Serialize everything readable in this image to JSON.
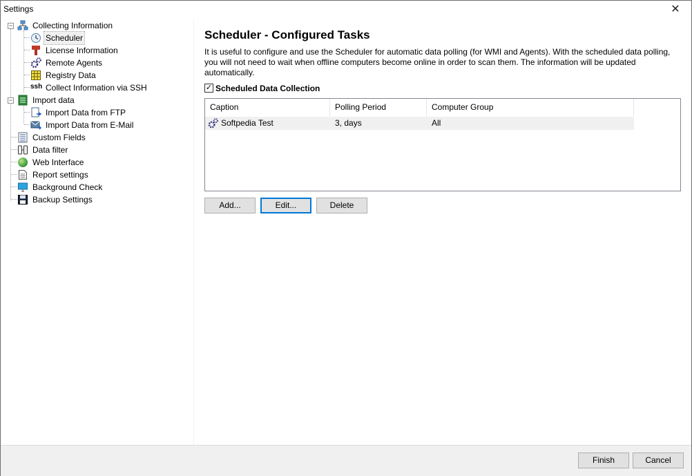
{
  "window": {
    "title": "Settings",
    "close_glyph": "✕"
  },
  "tree": {
    "nodes": [
      {
        "label": "Collecting Information",
        "icon": "network-icon",
        "expander": "−"
      },
      {
        "label": "Scheduler",
        "icon": "clock-icon"
      },
      {
        "label": "License Information",
        "icon": "license-icon"
      },
      {
        "label": "Remote Agents",
        "icon": "gears-icon"
      },
      {
        "label": "Registry Data",
        "icon": "grid-icon"
      },
      {
        "label": "Collect Information via SSH",
        "icon": "ssh-icon",
        "icon_text": "ssh"
      },
      {
        "label": "Import data",
        "icon": "import-icon",
        "expander": "−"
      },
      {
        "label": "Import Data from FTP",
        "icon": "ftp-import-icon"
      },
      {
        "label": "Import Data from E-Mail",
        "icon": "email-import-icon"
      },
      {
        "label": "Custom Fields",
        "icon": "list-icon"
      },
      {
        "label": "Data filter",
        "icon": "filter-icon"
      },
      {
        "label": "Web Interface",
        "icon": "globe-icon"
      },
      {
        "label": "Report settings",
        "icon": "report-icon"
      },
      {
        "label": "Background Check",
        "icon": "monitor-icon"
      },
      {
        "label": "Backup Settings",
        "icon": "floppy-icon"
      }
    ]
  },
  "main": {
    "heading": "Scheduler - Configured Tasks",
    "description": "It is useful to configure and use the Scheduler for automatic data polling (for WMI and Agents). With the scheduled data polling, you will not need to wait when offline computers become online in order to scan them. The information will be updated automatically.",
    "checkbox": {
      "label": "Scheduled Data Collection",
      "checked": true,
      "glyph": "✓"
    },
    "table": {
      "columns": [
        "Caption",
        "Polling Period",
        "Computer Group"
      ],
      "rows": [
        {
          "caption": "Softpedia Test",
          "period": "3, days",
          "group": "All"
        }
      ]
    },
    "buttons": {
      "add": "Add...",
      "edit": "Edit...",
      "delete": "Delete"
    }
  },
  "footer": {
    "finish": "Finish",
    "cancel": "Cancel"
  },
  "colors": {
    "selected_row": "#f0f0f0",
    "footer_bg": "#f0f0f0",
    "button_bg": "#e1e1e1",
    "focus": "#0078d7"
  }
}
